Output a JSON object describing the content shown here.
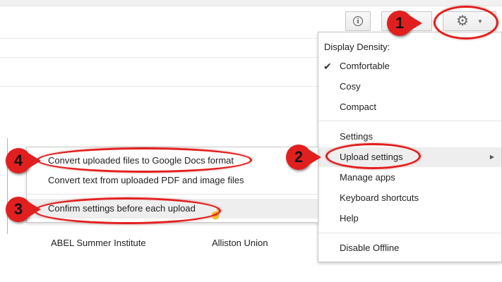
{
  "toolbar": {
    "info_icon": "info-icon",
    "gear_icon": "gear-icon",
    "caret_icon": "chevron-down-icon"
  },
  "settings_menu": {
    "header": "Display Density:",
    "density_options": [
      {
        "label": "Comfortable",
        "checked": true
      },
      {
        "label": "Cosy",
        "checked": false
      },
      {
        "label": "Compact",
        "checked": false
      }
    ],
    "settings": "Settings",
    "upload_settings": "Upload settings",
    "manage_apps": "Manage apps",
    "keyboard_shortcuts": "Keyboard shortcuts",
    "help": "Help",
    "disable_offline": "Disable Offline",
    "check_glyph": "✔",
    "arrow_glyph": "▶"
  },
  "upload_submenu": {
    "convert_docs": "Convert uploaded files to Google Docs format",
    "convert_text": "Convert text from uploaded PDF and image files",
    "confirm": "Confirm settings before each upload"
  },
  "list_row": {
    "col1": "ABEL Summer Institute",
    "col2": "Alliston Union"
  },
  "annotations": {
    "color": "#e21f1f",
    "markers": [
      "1",
      "2",
      "3",
      "4"
    ]
  }
}
